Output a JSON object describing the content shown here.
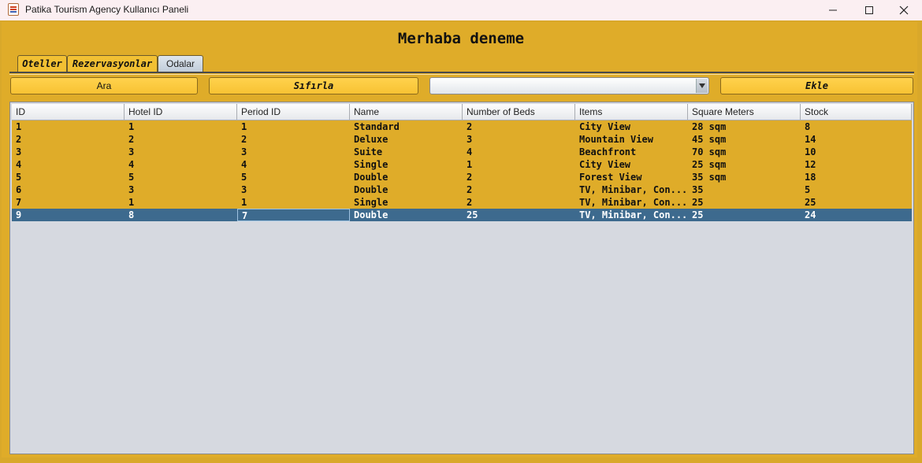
{
  "window": {
    "title": "Patika Tourism Agency Kullanıcı Paneli"
  },
  "header": {
    "welcome": "Merhaba deneme"
  },
  "tabs": [
    {
      "label": "Oteller",
      "active": false
    },
    {
      "label": "Rezervasyonlar",
      "active": false
    },
    {
      "label": "Odalar",
      "active": true
    }
  ],
  "toolbar": {
    "search_label": "Ara",
    "reset_label": "Sıfırla",
    "combo_value": "",
    "add_label": "Ekle"
  },
  "table": {
    "columns": [
      "ID",
      "Hotel ID",
      "Period ID",
      "Name",
      "Number of Beds",
      "Items",
      "Square Meters",
      "Stock"
    ],
    "rows": [
      [
        "1",
        "1",
        "1",
        "Standard",
        "2",
        "City View",
        "28 sqm",
        "8"
      ],
      [
        "2",
        "2",
        "2",
        "Deluxe",
        "3",
        "Mountain View",
        "45 sqm",
        "14"
      ],
      [
        "3",
        "3",
        "3",
        "Suite",
        "4",
        "Beachfront",
        "70 sqm",
        "10"
      ],
      [
        "4",
        "4",
        "4",
        "Single",
        "1",
        "City View",
        "25 sqm",
        "12"
      ],
      [
        "5",
        "5",
        "5",
        "Double",
        "2",
        "Forest View",
        "35 sqm",
        "18"
      ],
      [
        "6",
        "3",
        "3",
        "Double",
        "2",
        "TV, Minibar, Con...",
        "35",
        "5"
      ],
      [
        "7",
        "1",
        "1",
        "Single",
        "2",
        "TV, Minibar, Con...",
        "25",
        "25"
      ],
      [
        "9",
        "8",
        "7",
        "Double",
        "25",
        "TV, Minibar, Con...",
        "25",
        "24"
      ]
    ],
    "selected_row": 7
  },
  "colors": {
    "frame": "#dfac29",
    "selection": "#3d6a8e",
    "button": "#f7c233"
  },
  "icons": {
    "app": "java-app-icon",
    "minimize": "minimize-icon",
    "maximize": "maximize-icon",
    "close": "close-icon",
    "combo": "chevron-down-icon"
  }
}
